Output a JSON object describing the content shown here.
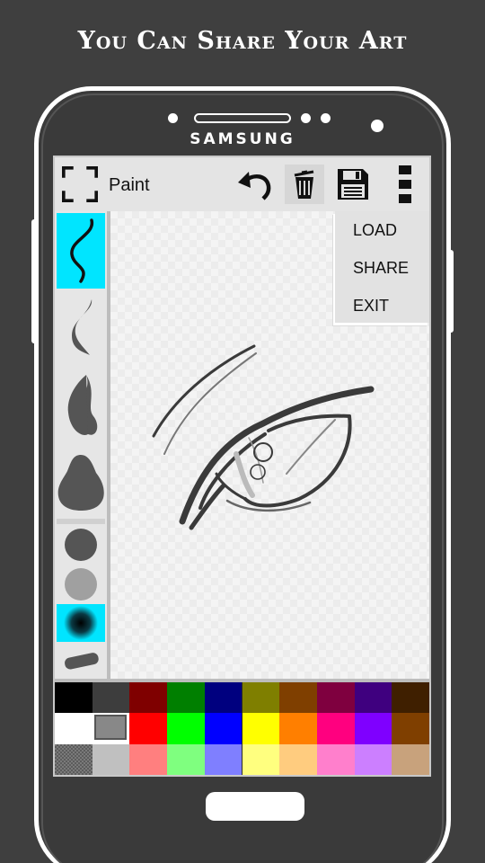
{
  "headline": "You Can Share Your Art",
  "phone": {
    "brand": "SAMSUNG"
  },
  "app": {
    "title": "Paint",
    "icons": [
      "fullscreen-icon",
      "undo-icon",
      "trash-icon",
      "save-icon",
      "overflow-menu-icon"
    ]
  },
  "menu": {
    "items": [
      "LOAD",
      "SHARE",
      "EXIT"
    ]
  },
  "tools": {
    "strokes": [
      "thin-stroke",
      "medium-stroke",
      "thick-stroke",
      "blob-stroke"
    ],
    "selected_stroke": "thin-stroke",
    "brushes": [
      "solid-brush",
      "soft-brush",
      "airbrush",
      "marker-brush"
    ],
    "selected_brush": "airbrush"
  },
  "palette": {
    "row1": [
      "#000000",
      "#3d3d3d",
      "#7f0000",
      "#007f00",
      "#00007f",
      "#7f7f00",
      "#7f3f00",
      "#7f003f",
      "#3f007f",
      "#3f1f00"
    ],
    "row2": [
      "#ffffff",
      "#888888",
      "#ff0000",
      "#00ff00",
      "#0000ff",
      "#ffff00",
      "#ff7f00",
      "#ff007f",
      "#7f00ff",
      "#7f3f00"
    ],
    "row3": [
      "#7a7a7a",
      "#c0c0c0",
      "#ff7f7f",
      "#7fff7f",
      "#7f7fff",
      "#ffff7f",
      "#ffcc7f",
      "#ff7fcc",
      "#cc7fff",
      "#c8a27c"
    ],
    "foreground": "#ffffff",
    "background": "#888888"
  }
}
